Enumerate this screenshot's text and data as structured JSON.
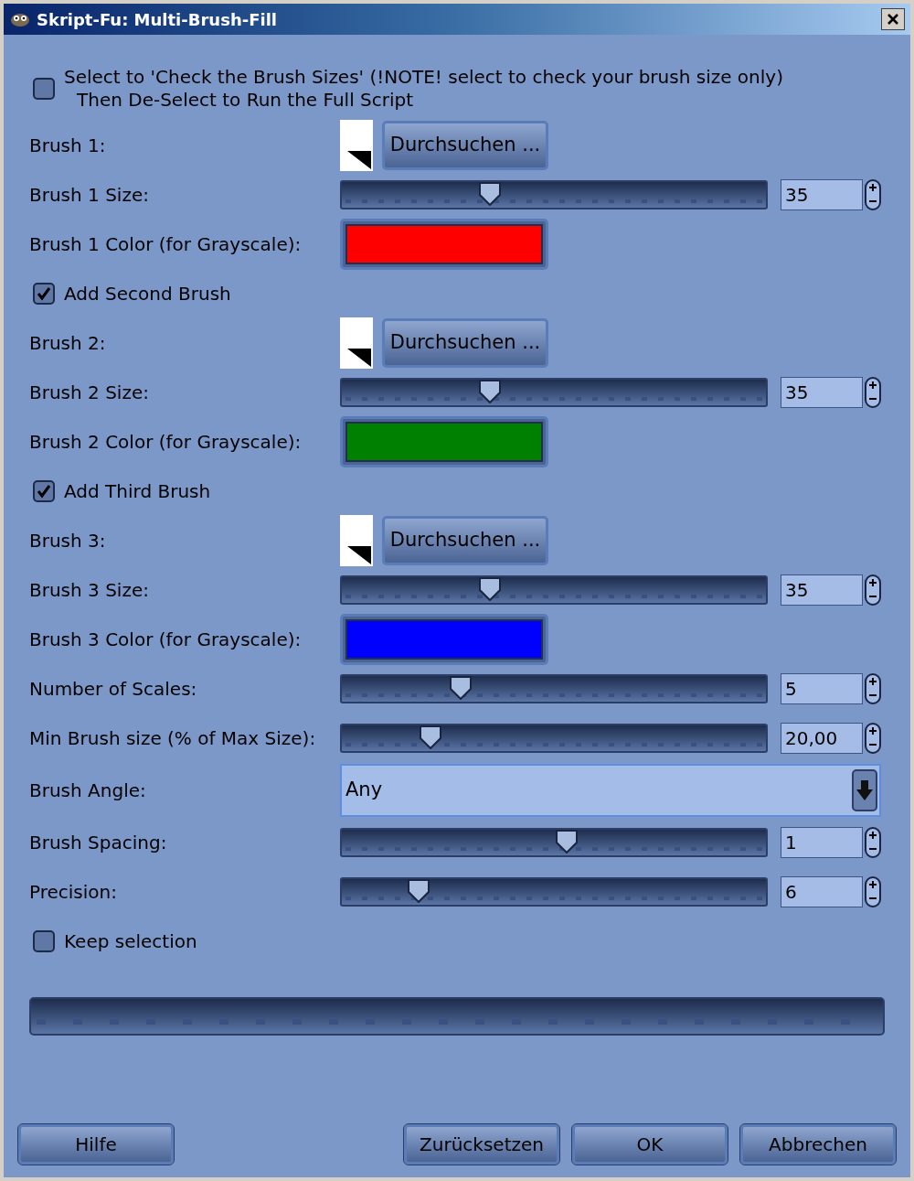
{
  "window": {
    "title": "Skript-Fu: Multi-Brush-Fill"
  },
  "rows": [
    {
      "kind": "checkbox",
      "label": "Select to 'Check the Brush Sizes' (!NOTE! select to check your brush size only)",
      "label_line_2": "Then De-Select to Run the Full Script",
      "checked": false
    },
    {
      "kind": "brush",
      "label": "Brush 1:",
      "button": "Durchsuchen ..."
    },
    {
      "kind": "slider",
      "label": "Brush 1 Size:",
      "level": 0.35,
      "value": "35"
    },
    {
      "kind": "color",
      "label": "Brush 1 Color (for Grayscale):",
      "color": "#ff0000"
    },
    {
      "kind": "checkbox",
      "label": "Add Second Brush",
      "checked": true
    },
    {
      "kind": "brush",
      "label": "Brush 2:",
      "button": "Durchsuchen ..."
    },
    {
      "kind": "slider",
      "label": "Brush 2 Size:",
      "level": 0.35,
      "value": "35"
    },
    {
      "kind": "color",
      "label": "Brush 2 Color (for Grayscale):",
      "color": "#008000"
    },
    {
      "kind": "checkbox",
      "label": "Add Third Brush",
      "checked": true
    },
    {
      "kind": "brush",
      "label": "Brush 3:",
      "button": "Durchsuchen ..."
    },
    {
      "kind": "slider",
      "label": "Brush 3 Size:",
      "level": 0.35,
      "value": "35"
    },
    {
      "kind": "color",
      "label": "Brush 3 Color (for Grayscale):",
      "color": "#0000ff"
    },
    {
      "kind": "slider",
      "label": "Number of Scales:",
      "level": 0.28,
      "value": "5"
    },
    {
      "kind": "slider",
      "label": "Min Brush size (% of Max Size):",
      "level": 0.21,
      "value": "20,00"
    },
    {
      "kind": "dropdown",
      "label": "Brush Angle:",
      "value": "Any"
    },
    {
      "kind": "slider",
      "label": "Brush Spacing:",
      "level": 0.53,
      "value": "1"
    },
    {
      "kind": "slider",
      "label": "Precision:",
      "level": 0.18,
      "value": "6"
    },
    {
      "kind": "checkbox",
      "label": "Keep selection",
      "checked": false
    }
  ],
  "progress": {
    "level": 0
  },
  "buttons_left": [
    "Hilfe"
  ],
  "buttons_right": [
    "Zurücksetzen",
    "OK",
    "Abbrechen"
  ]
}
